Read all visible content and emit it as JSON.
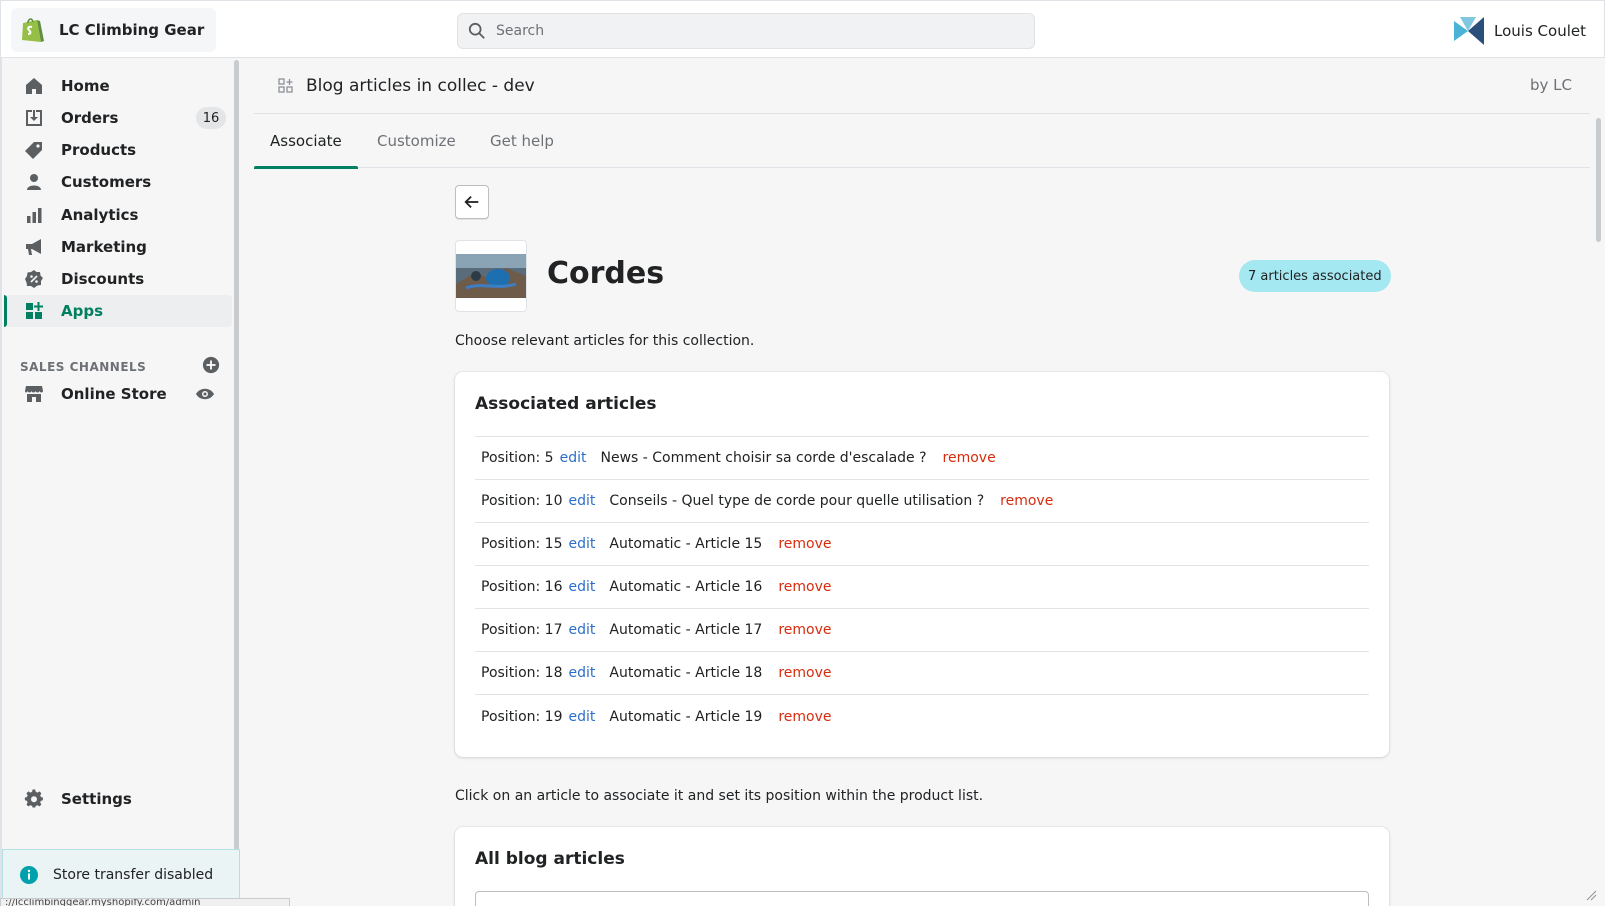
{
  "topbar": {
    "store_name": "LC Climbing Gear",
    "search_placeholder": "Search",
    "user_name": "Louis Coulet"
  },
  "sidebar": {
    "items": [
      {
        "label": "Home",
        "icon": "home-icon"
      },
      {
        "label": "Orders",
        "icon": "orders-icon",
        "badge": "16"
      },
      {
        "label": "Products",
        "icon": "tag-icon"
      },
      {
        "label": "Customers",
        "icon": "person-icon"
      },
      {
        "label": "Analytics",
        "icon": "bar-chart-icon"
      },
      {
        "label": "Marketing",
        "icon": "megaphone-icon"
      },
      {
        "label": "Discounts",
        "icon": "discount-icon"
      },
      {
        "label": "Apps",
        "icon": "apps-icon"
      }
    ],
    "sales_channels_header": "SALES CHANNELS",
    "online_store": "Online Store",
    "settings": "Settings",
    "store_transfer": "Store transfer disabled",
    "url_tooltip": "://lcclimbinggear.myshopify.com/admin"
  },
  "app": {
    "title": "Blog articles in collec - dev",
    "by": "by LC",
    "tabs": [
      "Associate",
      "Customize",
      "Get help"
    ]
  },
  "collection": {
    "title": "Cordes",
    "badge": "7 articles associated",
    "description": "Choose relevant articles for this collection."
  },
  "associated": {
    "title": "Associated articles",
    "edit_label": "edit",
    "remove_label": "remove",
    "rows": [
      {
        "position": "Position: 5",
        "title": "News - Comment choisir sa corde d'escalade ?"
      },
      {
        "position": "Position: 10",
        "title": "Conseils - Quel type de corde pour quelle utilisation ?"
      },
      {
        "position": "Position: 15",
        "title": "Automatic - Article 15"
      },
      {
        "position": "Position: 16",
        "title": "Automatic - Article 16"
      },
      {
        "position": "Position: 17",
        "title": "Automatic - Article 17"
      },
      {
        "position": "Position: 18",
        "title": "Automatic - Article 18"
      },
      {
        "position": "Position: 19",
        "title": "Automatic - Article 19"
      }
    ]
  },
  "all_articles": {
    "instruction": "Click on an article to associate it and set its position within the product list.",
    "title": "All blog articles"
  },
  "colors": {
    "accent": "#008060",
    "link": "#2c6ecb",
    "danger": "#d72c0d",
    "badge_bg": "#a4e8f2"
  }
}
